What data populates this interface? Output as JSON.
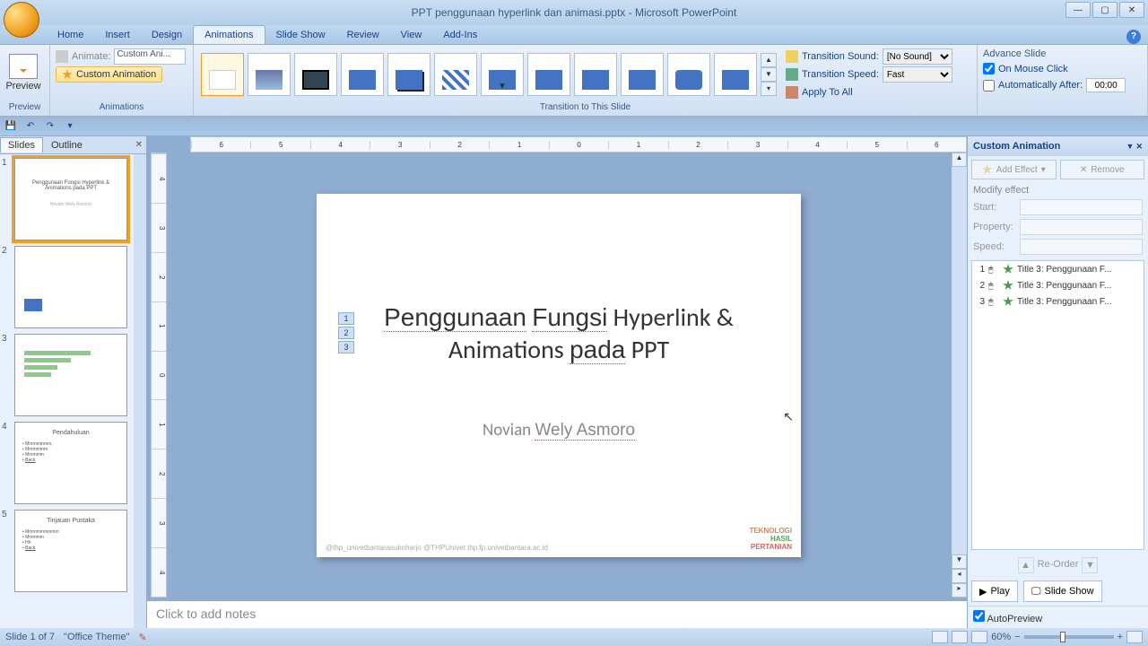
{
  "window": {
    "title": "PPT penggunaan hyperlink dan animasi.pptx - Microsoft PowerPoint"
  },
  "tabs": [
    "Home",
    "Insert",
    "Design",
    "Animations",
    "Slide Show",
    "Review",
    "View",
    "Add-Ins"
  ],
  "active_tab": "Animations",
  "ribbon": {
    "preview": {
      "label": "Preview",
      "group": "Preview"
    },
    "animations": {
      "animate_label": "Animate:",
      "animate_value": "Custom Ani...",
      "custom_btn": "Custom Animation",
      "group": "Animations"
    },
    "transition": {
      "group": "Transition to This Slide",
      "sound_label": "Transition Sound:",
      "sound_value": "[No Sound]",
      "speed_label": "Transition Speed:",
      "speed_value": "Fast",
      "apply_all": "Apply To All"
    },
    "advance": {
      "group": "Advance Slide",
      "on_click": "On Mouse Click",
      "auto_after": "Automatically After:",
      "auto_value": "00:00"
    }
  },
  "pane_tabs": {
    "slides": "Slides",
    "outline": "Outline"
  },
  "thumbnails": [
    {
      "n": 1,
      "title": "Penggunaan Fungsi Hyperlink & Animations pada PPT",
      "sub": "Novian Wely Asmoro",
      "selected": true
    },
    {
      "n": 2,
      "title": ""
    },
    {
      "n": 3,
      "title": ""
    },
    {
      "n": 4,
      "title": "Pendahuluan"
    },
    {
      "n": 5,
      "title": "Tinjauan Pustaka"
    }
  ],
  "slide": {
    "title": "Penggunaan Fungsi Hyperlink & Animations pada PPT",
    "subtitle": "Novian Wely Asmoro",
    "footer_left": "@thp_univetbantarasukoharjo    @THPUnivet    thp.fp.univetbantara.ac.id",
    "logo1": "TEKNOLOGI",
    "logo2": "HASIL",
    "logo3": "PERTANIAN",
    "anim_tags": [
      "1",
      "2",
      "3"
    ]
  },
  "notes_placeholder": "Click to add notes",
  "custom_anim": {
    "title": "Custom Animation",
    "add_effect": "Add Effect",
    "remove": "Remove",
    "modify": "Modify effect",
    "start": "Start:",
    "property": "Property:",
    "speed": "Speed:",
    "items": [
      {
        "n": "1",
        "label": "Title 3: Penggunaan F..."
      },
      {
        "n": "2",
        "label": "Title 3: Penggunaan F..."
      },
      {
        "n": "3",
        "label": "Title 3: Penggunaan F..."
      }
    ],
    "reorder": "Re-Order",
    "play": "Play",
    "slideshow": "Slide Show",
    "autopreview": "AutoPreview"
  },
  "status": {
    "slide": "Slide 1 of 7",
    "theme": "\"Office Theme\"",
    "zoom": "60%"
  }
}
